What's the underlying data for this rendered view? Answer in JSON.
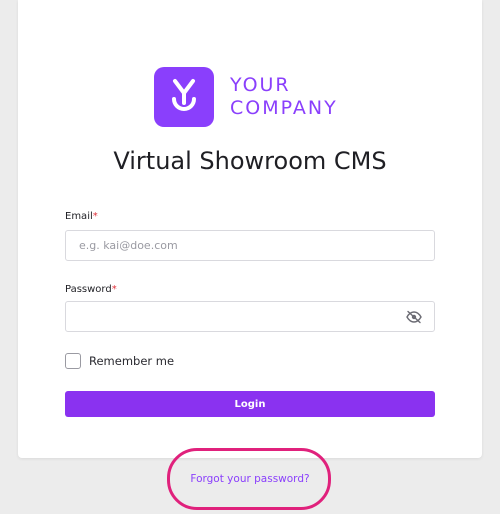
{
  "logo": {
    "line1": "YOUR",
    "line2": "COMPANY",
    "brand_color": "#8a3ffc"
  },
  "title": "Virtual Showroom CMS",
  "email": {
    "label": "Email",
    "required_mark": "*",
    "placeholder": "e.g. kai@doe.com",
    "value": ""
  },
  "password": {
    "label": "Password",
    "required_mark": "*",
    "value": "",
    "toggle_icon": "eye-off-icon"
  },
  "remember": {
    "label": "Remember me",
    "checked": false
  },
  "login_button": {
    "label": "Login",
    "color": "#8a32f0"
  },
  "forgot_link": {
    "label": "Forgot your password?",
    "highlight_color": "#e0217c"
  }
}
